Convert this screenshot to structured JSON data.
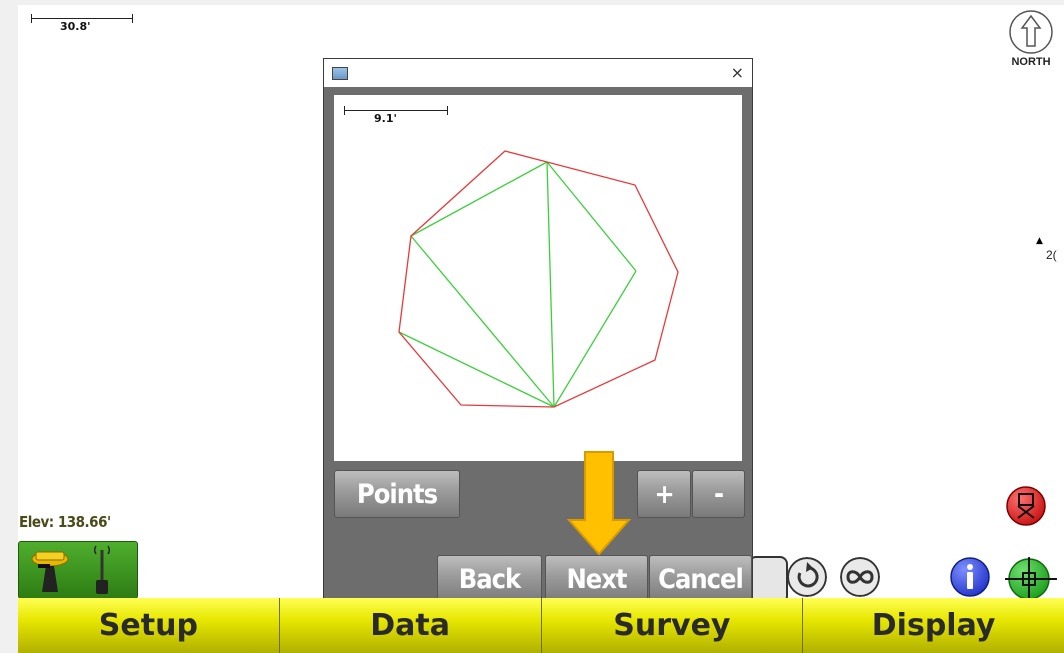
{
  "map": {
    "scale_label": "30.8'",
    "north_label": "NORTH",
    "point_label": "2("
  },
  "status": {
    "elevation": "Elev: 138.66'"
  },
  "tabs": [
    {
      "label": "Setup"
    },
    {
      "label": "Data"
    },
    {
      "label": "Survey"
    },
    {
      "label": "Display"
    }
  ],
  "dialog": {
    "close_glyph": "×",
    "preview_scale_label": "9.1'",
    "buttons": {
      "points": "Points",
      "zoom_in": "+",
      "zoom_out": "-",
      "back": "Back",
      "next": "Next",
      "cancel": "Cancel"
    }
  },
  "colors": {
    "boundary": "#e63a3a",
    "triangulation": "#3ccf3c",
    "tab_bar": "#e7e700",
    "highlight_arrow": "#ffc000"
  },
  "icons": [
    "north-arrow-icon",
    "gps-receiver-icon",
    "radio-antenna-icon",
    "square-view-icon",
    "rotate-icon",
    "infinity-icon",
    "info-icon",
    "crosshair-icon",
    "record-icon",
    "window-icon",
    "close-icon"
  ]
}
